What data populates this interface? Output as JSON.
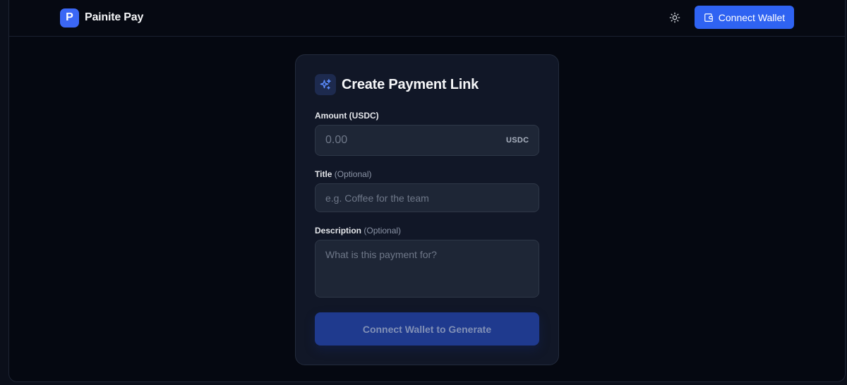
{
  "app": {
    "logo_letter": "P",
    "name": "Painite Pay"
  },
  "header": {
    "theme_toggle_icon": "sun-icon",
    "connect_wallet_label": "Connect Wallet",
    "connect_wallet_icon": "wallet-icon"
  },
  "form": {
    "title": "Create Payment Link",
    "title_icon": "sparkles-icon",
    "amount": {
      "label": "Amount (USDC)",
      "placeholder": "0.00",
      "value": "",
      "suffix": "USDC"
    },
    "title_field": {
      "label": "Title",
      "optional_label": "(Optional)",
      "placeholder": "e.g. Coffee for the team",
      "value": ""
    },
    "description": {
      "label": "Description",
      "optional_label": "(Optional)",
      "placeholder": "What is this payment for?",
      "value": ""
    },
    "submit_label": "Connect Wallet to Generate"
  },
  "colors": {
    "accent": "#2f63f2",
    "background": "#050811",
    "card": "#111727",
    "disabled_button": "#1f3a8e"
  }
}
